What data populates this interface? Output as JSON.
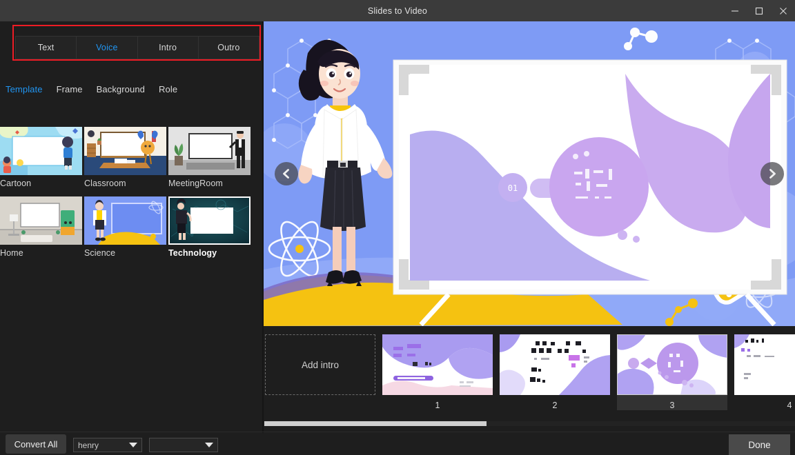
{
  "window": {
    "title": "Slides to Video",
    "controls": [
      {
        "name": "minimize-button",
        "glyph": "minimize"
      },
      {
        "name": "maximize-button",
        "glyph": "maximize"
      },
      {
        "name": "close-button",
        "glyph": "close"
      }
    ]
  },
  "tabs": {
    "highlighted": true,
    "highlight_color": "#ee1c25",
    "active": "Voice",
    "items": [
      {
        "label": "Text",
        "active": false
      },
      {
        "label": "Voice",
        "active": true
      },
      {
        "label": "Intro",
        "active": false
      },
      {
        "label": "Outro",
        "active": false
      }
    ]
  },
  "subtabs": {
    "active": "Template",
    "items": [
      {
        "label": "Template",
        "active": true
      },
      {
        "label": "Frame",
        "active": false
      },
      {
        "label": "Background",
        "active": false
      },
      {
        "label": "Role",
        "active": false
      }
    ]
  },
  "templates": {
    "selected": "Technology",
    "items": [
      {
        "label": "Cartoon",
        "selected": false
      },
      {
        "label": "Classroom",
        "selected": false
      },
      {
        "label": "MeetingRoom",
        "selected": false
      },
      {
        "label": "Home",
        "selected": false
      },
      {
        "label": "Science",
        "selected": false
      },
      {
        "label": "Technology",
        "selected": true
      }
    ]
  },
  "preview": {
    "background_color": "#7e9bf5",
    "slide_badge": "01",
    "prev_arrow_icon": "chevron-left-icon",
    "next_arrow_icon": "chevron-right-icon"
  },
  "filmstrip": {
    "add_intro_label": "Add intro",
    "selected_slide": "3",
    "slides": [
      {
        "number": "1",
        "selected": false
      },
      {
        "number": "2",
        "selected": false
      },
      {
        "number": "3",
        "selected": true
      },
      {
        "number": "4",
        "selected": false
      }
    ],
    "scroll_position_percent": 42
  },
  "bottom": {
    "convert_all_label": "Convert All",
    "voice_value": "henry",
    "voice_placeholder": "",
    "language_value": "",
    "language_placeholder": "",
    "done_label": "Done"
  },
  "colors": {
    "accent_blue": "#2196f3",
    "highlight_red": "#ee1c25",
    "panel_bg": "#1e1e1e",
    "titlebar_bg": "#3b3b3b",
    "slide_purple": "#b79ee8",
    "slide_lavender": "#aba6ef",
    "accent_yellow": "#f8c10a"
  }
}
